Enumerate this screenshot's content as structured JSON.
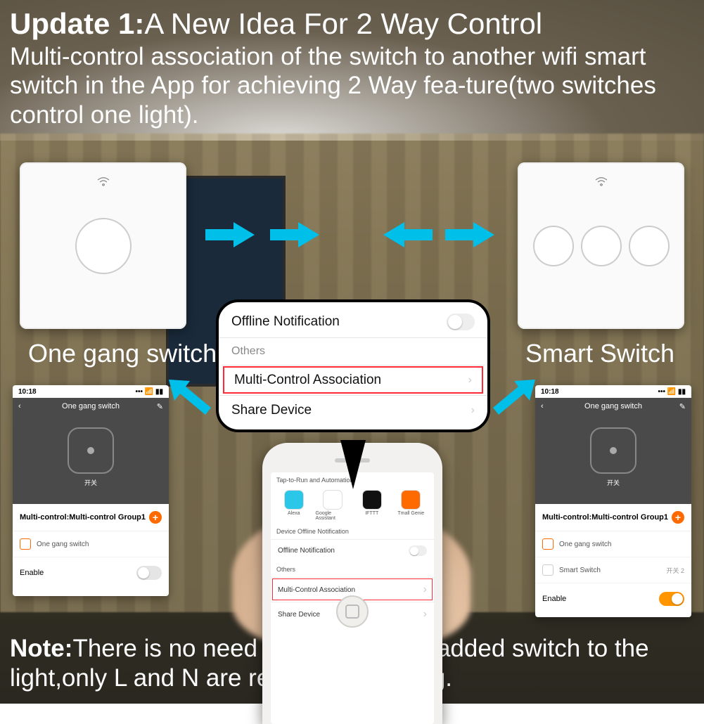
{
  "title_strong": "Update 1:",
  "title_rest": "A New Idea For 2 Way Control",
  "description": "Multi-control association of the switch to another wifi smart switch in the App for achieving 2 Way fea-ture(two switches control one light).",
  "note_strong": "Note:",
  "note_rest": "There is no need to wire the new added switch to the light,only L and N are required for wiring.",
  "left_caption": "One gang switch",
  "right_caption": "Smart Switch",
  "callout": {
    "offline_notification": "Offline Notification",
    "others": "Others",
    "multi_control_assoc": "Multi-Control Association",
    "share_device": "Share Device"
  },
  "center_phone": {
    "tap_to_run": "Tap-to-Run and Automation",
    "services": {
      "alexa": "Alexa",
      "google": "Google Assistant",
      "ifttt": "IFTTT",
      "tmall": "Tmall Genie"
    },
    "device_offline_notify": "Device Offline Notification",
    "offline_notification": "Offline Notification",
    "others": "Others",
    "multi_control_assoc": "Multi-Control Association",
    "share_device": "Share Device"
  },
  "appshot": {
    "time": "10:18",
    "wifi": "📶",
    "title": "One gang switch",
    "back": "‹",
    "edit": "✎",
    "device_label": "开关",
    "multi_control_group": "Multi-control:Multi-control Group1",
    "one_gang_item": "One gang switch",
    "smart_switch_item": "Smart Switch",
    "smart_switch_meta": "开关 2",
    "enable": "Enable"
  }
}
